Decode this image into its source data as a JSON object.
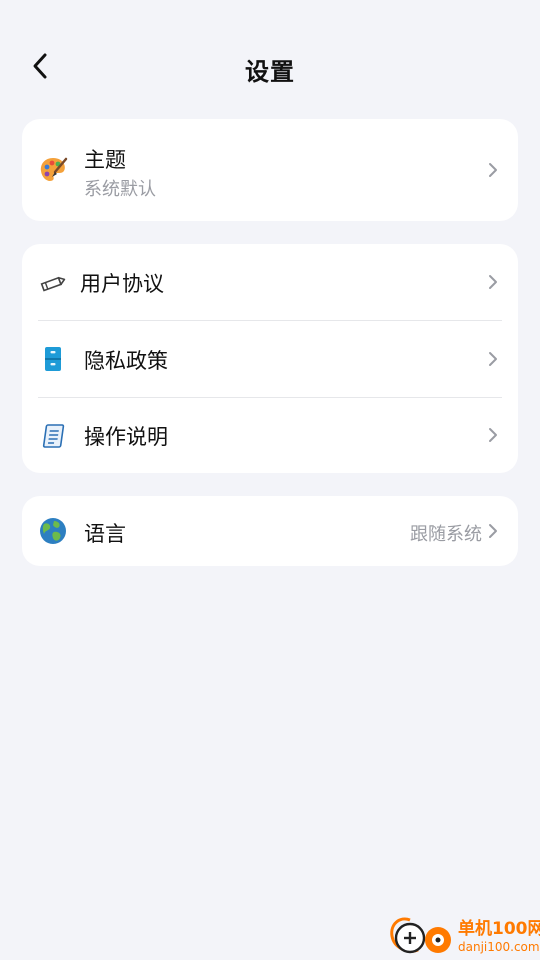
{
  "header": {
    "title": "设置",
    "back_icon": "chevron-left-icon"
  },
  "theme_card": {
    "icon": "palette-icon",
    "label": "主题",
    "sub": "系统默认"
  },
  "docs_card": {
    "items": [
      {
        "icon": "pencil-icon",
        "label": "用户协议"
      },
      {
        "icon": "file-cabinet-icon",
        "label": "隐私政策"
      },
      {
        "icon": "document-icon",
        "label": "操作说明"
      }
    ]
  },
  "language_card": {
    "icon": "globe-icon",
    "label": "语言",
    "value": "跟随系统"
  },
  "watermark": {
    "title": "单机100网",
    "url": "danji100.com"
  },
  "colors": {
    "background": "#f3f4f9",
    "card": "#ffffff",
    "secondary_text": "#9a9ca3",
    "watermark": "#ff7a00"
  }
}
